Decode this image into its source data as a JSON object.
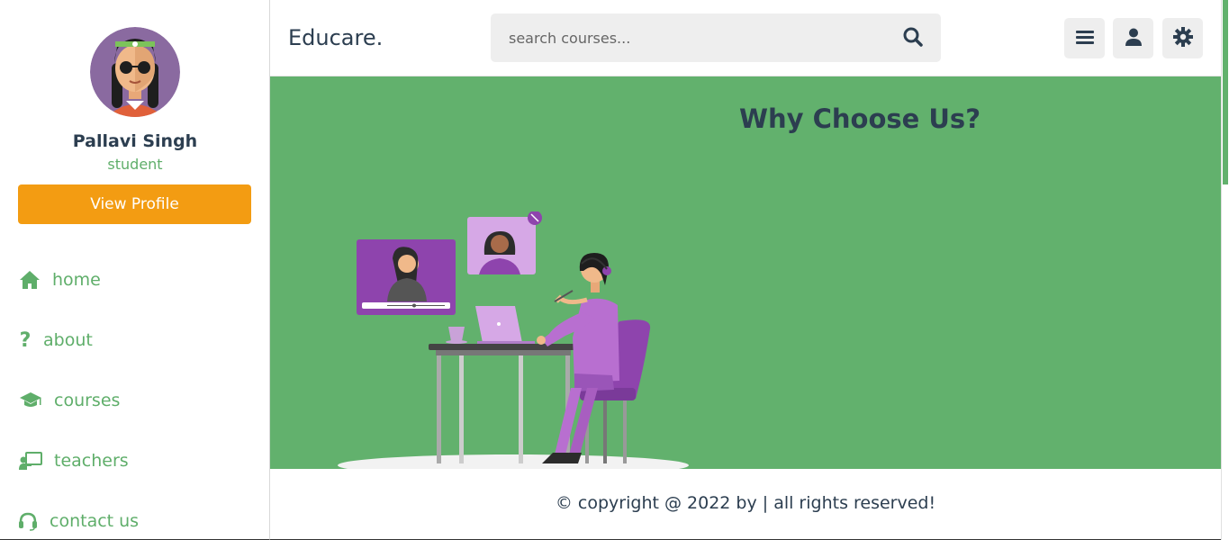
{
  "sidebar": {
    "user_name": "Pallavi Singh",
    "user_role": "student",
    "view_profile_label": "View Profile",
    "nav": [
      {
        "label": "home",
        "icon": "home-icon"
      },
      {
        "label": "about",
        "icon": "question-icon"
      },
      {
        "label": "courses",
        "icon": "graduation-cap-icon"
      },
      {
        "label": "teachers",
        "icon": "chalkboard-teacher-icon"
      },
      {
        "label": "contact us",
        "icon": "headset-icon"
      }
    ]
  },
  "header": {
    "logo": "Educare.",
    "search_placeholder": "search courses...",
    "buttons": [
      "menu-icon",
      "user-icon",
      "gear-icon"
    ]
  },
  "main": {
    "title": "Why Choose Us?"
  },
  "footer": {
    "text": "© copyright @ 2022 by | all rights reserved!"
  },
  "colors": {
    "accent_green": "#62b16d",
    "primary_text": "#2c3e50",
    "orange_button": "#f39c12",
    "purple": "#8e44ad"
  }
}
